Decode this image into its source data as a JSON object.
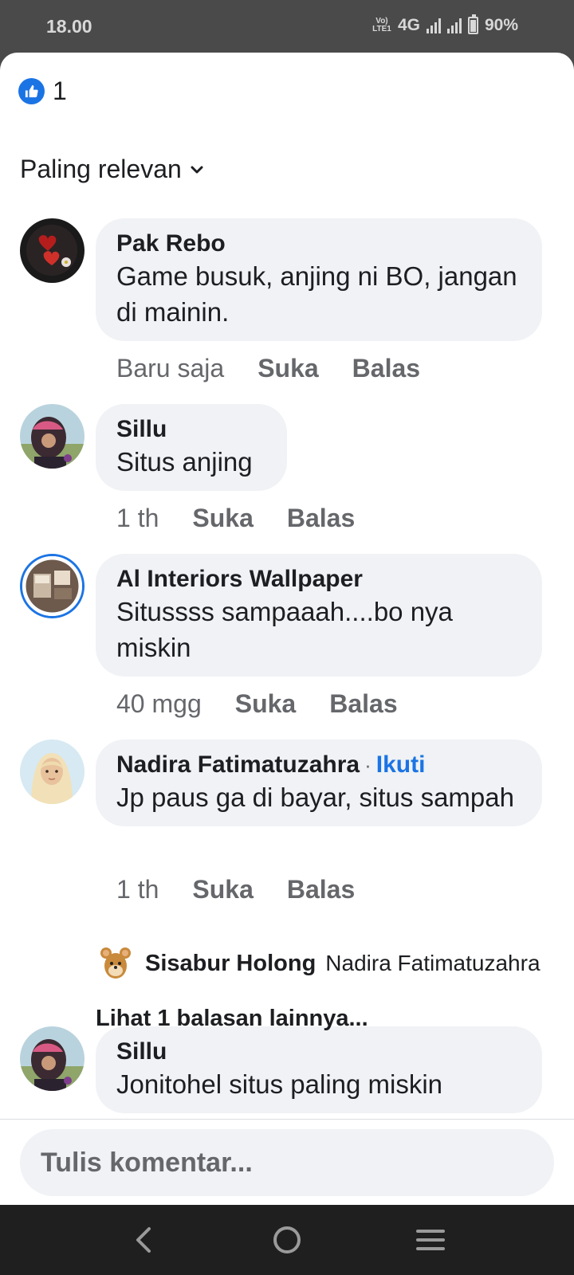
{
  "status_bar": {
    "time": "18.00",
    "volte": "Vo) LTE1",
    "network": "4G",
    "battery": "90%"
  },
  "reactions": {
    "icon": "thumbs-up-icon",
    "count": "1",
    "color": "#1b74e4"
  },
  "sort": {
    "label": "Paling relevan"
  },
  "comments": [
    {
      "name": "Pak Rebo",
      "text": "Game busuk, anjing ni BO, jangan di mainin.",
      "time": "Baru saja",
      "like": "Suka",
      "reply": "Balas"
    },
    {
      "name": "Sillu",
      "text": "Situs anjing",
      "time": "1 th",
      "like": "Suka",
      "reply": "Balas"
    },
    {
      "name": "Al Interiors Wallpaper",
      "text": "Situssss sampaaah....bo nya miskin",
      "time": "40 mgg",
      "like": "Suka",
      "reply": "Balas"
    },
    {
      "name": "Nadira Fatimatuzahra",
      "follow": "Ikuti",
      "text": "Jp paus ga di bayar, situs sampah",
      "time": "1 th",
      "like": "Suka",
      "reply": "Balas"
    },
    {
      "name": "Sillu",
      "text": "Jonitohel situs paling miskin"
    }
  ],
  "reply_preview": {
    "name": "Sisabur Holong",
    "text": "Nadira Fatimatuzahra"
  },
  "more_replies": "Lihat 1 balasan lainnya...",
  "composer": {
    "placeholder": "Tulis komentar..."
  },
  "nav": {
    "back": "back-icon",
    "home": "home-icon",
    "recents": "recents-icon"
  }
}
